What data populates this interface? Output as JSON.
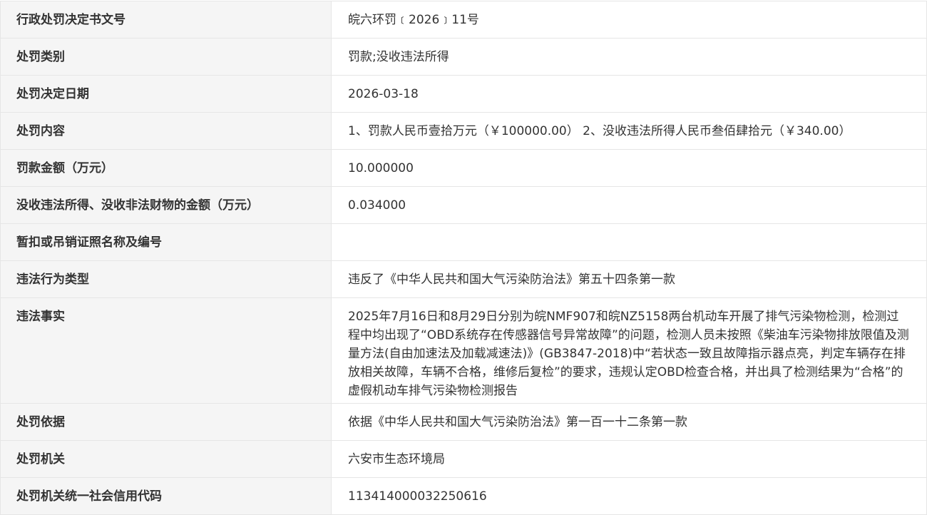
{
  "rows": [
    {
      "label": "行政处罚决定书文号",
      "value": "皖六环罚﹝2026﹞11号"
    },
    {
      "label": "处罚类别",
      "value": "罚款;没收违法所得"
    },
    {
      "label": "处罚决定日期",
      "value": "2026-03-18"
    },
    {
      "label": "处罚内容",
      "value": "1、罚款人民币壹拾万元（￥100000.00） 2、没收违法所得人民币叁佰肆拾元（￥340.00）"
    },
    {
      "label": "罚款金额（万元）",
      "value": "10.000000"
    },
    {
      "label": "没收违法所得、没收非法财物的金额（万元）",
      "value": "0.034000"
    },
    {
      "label": "暂扣或吊销证照名称及编号",
      "value": ""
    },
    {
      "label": "违法行为类型",
      "value": "违反了《中华人民共和国大气污染防治法》第五十四条第一款"
    },
    {
      "label": "违法事实",
      "value": "2025年7月16日和8月29日分别为皖NMF907和皖NZ5158两台机动车开展了排气污染物检测，检测过程中均出现了“OBD系统存在传感器信号异常故障”的问题，检测人员未按照《柴油车污染物排放限值及测量方法(自由加速法及加载减速法)》(GB3847-2018)中“若状态一致且故障指示器点亮，判定车辆存在排放相关故障，车辆不合格，维修后复检”的要求，违规认定OBD检查合格，并出具了检测结果为“合格”的虚假机动车排气污染物检测报告"
    },
    {
      "label": "处罚依据",
      "value": "依据《中华人民共和国大气污染防治法》第一百一十二条第一款"
    },
    {
      "label": "处罚机关",
      "value": "六安市生态环境局"
    },
    {
      "label": "处罚机关统一社会信用代码",
      "value": "11341400003225061​6"
    }
  ]
}
